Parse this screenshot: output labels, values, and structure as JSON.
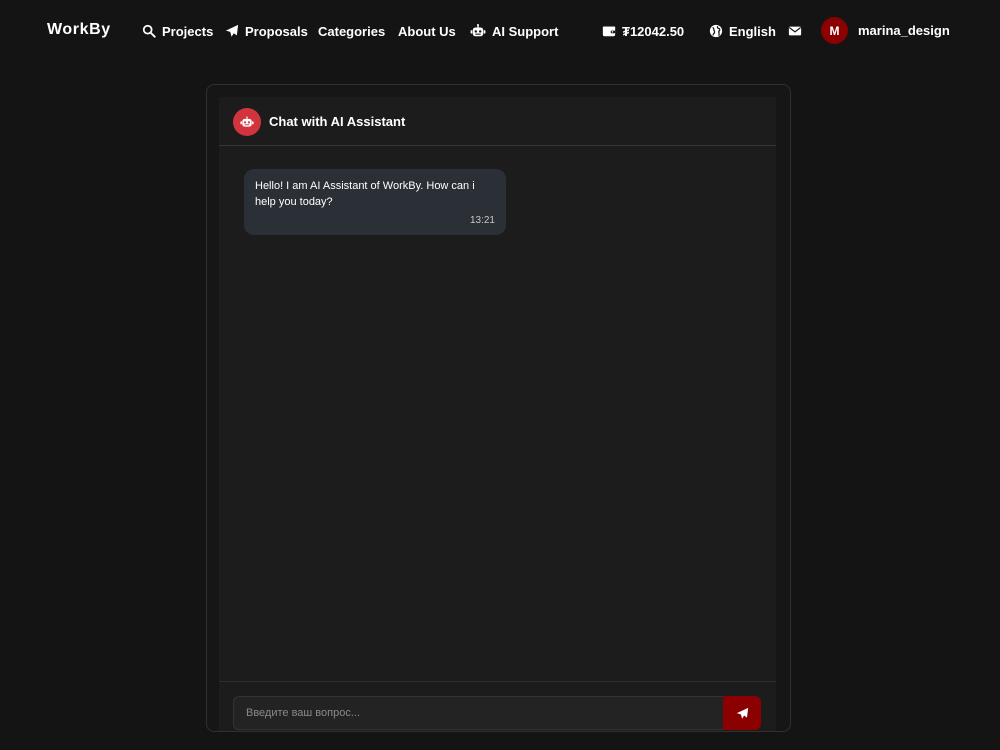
{
  "nav": {
    "brand": "WorkBy",
    "projects_label": "Projects",
    "proposals_label": "Proposals",
    "categories_label": "Categories",
    "about_label": "About Us",
    "ai_support_label": "AI Support",
    "balance": "₮12042.50",
    "language": "English",
    "avatar_initial": "M",
    "username": "marina_design",
    "icons": {
      "projects": "search-icon",
      "proposals": "paper-plane-icon",
      "ai_support": "robot-icon",
      "balance": "wallet-icon",
      "language": "globe-icon",
      "messages": "envelope-icon"
    }
  },
  "chat": {
    "title": "Chat with AI Assistant",
    "header_icon": "robot-icon",
    "messages": [
      {
        "sender": "assistant",
        "text": "Hello! I am AI Assistant of WorkBy. How can i help you today?",
        "time": "13:21"
      }
    ],
    "input_placeholder": "Введите ваш вопрос...",
    "input_value": "",
    "send_icon": "paper-plane-icon"
  },
  "colors": {
    "background": "#141414",
    "panel": "#1c1c1c",
    "accent_dark_red": "#8b0000",
    "bot_avatar_red": "#d2343f",
    "bubble": "#2b2f36"
  }
}
